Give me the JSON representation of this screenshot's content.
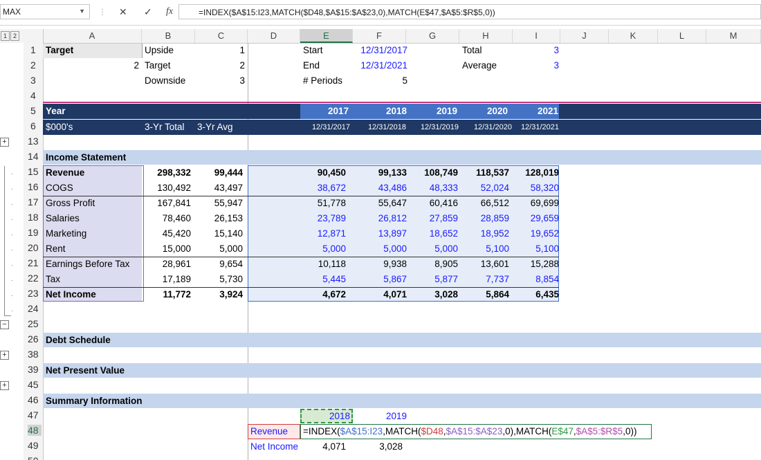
{
  "namebox": "MAX",
  "formula": "=INDEX($A$15:I23,MATCH($D48,$A$15:$A$23,0),MATCH(E$47,$A$5:$R$5,0))",
  "formula_parts": {
    "p1": "=INDEX(",
    "p2": "$A$15:I23",
    "p3": ",MATCH(",
    "p4": "$D48",
    "p5": ",",
    "p6": "$A$15:$A$23",
    "p7": ",0),MATCH(",
    "p8": "E$47",
    "p9": ",",
    "p10": "$A$5:$R$5",
    "p11": ",0))"
  },
  "columns": [
    "A",
    "B",
    "C",
    "D",
    "E",
    "F",
    "G",
    "H",
    "I",
    "J",
    "K",
    "L",
    "M"
  ],
  "outline_levels": [
    "1",
    "2"
  ],
  "rows": [
    "1",
    "2",
    "3",
    "4",
    "5",
    "6",
    "13",
    "14",
    "15",
    "16",
    "17",
    "18",
    "19",
    "20",
    "21",
    "22",
    "23",
    "24",
    "25",
    "26",
    "38",
    "39",
    "45",
    "46",
    "47",
    "48",
    "49",
    "50"
  ],
  "top": {
    "a1": "Target",
    "b1": "Upside",
    "c1": "1",
    "a2": "2",
    "b2": "Target",
    "c2": "2",
    "b3": "Downside",
    "c3": "3",
    "e1": "Start",
    "f1": "12/31/2017",
    "e2": "End",
    "f2": "12/31/2021",
    "e3": "# Periods",
    "f3": "5",
    "h1": "Total",
    "i1": "3",
    "h2": "Average",
    "i2": "3"
  },
  "header": {
    "year": "Year",
    "units": "$000's",
    "total": "3-Yr Total",
    "avg": "3-Yr Avg",
    "years": [
      "2017",
      "2018",
      "2019",
      "2020",
      "2021"
    ],
    "dates": [
      "12/31/2017",
      "12/31/2018",
      "12/31/2019",
      "12/31/2020",
      "12/31/2021"
    ]
  },
  "income": {
    "title": "Income Statement",
    "rows": [
      {
        "label": "Revenue",
        "total": "298,332",
        "avg": "99,444",
        "v": [
          "90,450",
          "99,133",
          "108,749",
          "118,537",
          "128,019"
        ]
      },
      {
        "label": "COGS",
        "total": "130,492",
        "avg": "43,497",
        "v": [
          "38,672",
          "43,486",
          "48,333",
          "52,024",
          "58,320"
        ]
      },
      {
        "label": "Gross Profit",
        "total": "167,841",
        "avg": "55,947",
        "v": [
          "51,778",
          "55,647",
          "60,416",
          "66,512",
          "69,699"
        ]
      },
      {
        "label": "Salaries",
        "total": "78,460",
        "avg": "26,153",
        "v": [
          "23,789",
          "26,812",
          "27,859",
          "28,859",
          "29,659"
        ]
      },
      {
        "label": "Marketing",
        "total": "45,420",
        "avg": "15,140",
        "v": [
          "12,871",
          "13,897",
          "18,652",
          "18,952",
          "19,652"
        ]
      },
      {
        "label": "Rent",
        "total": "15,000",
        "avg": "5,000",
        "v": [
          "5,000",
          "5,000",
          "5,000",
          "5,100",
          "5,100"
        ]
      },
      {
        "label": "Earnings Before Tax",
        "total": "28,961",
        "avg": "9,654",
        "v": [
          "10,118",
          "9,938",
          "8,905",
          "13,601",
          "15,288"
        ]
      },
      {
        "label": "Tax",
        "total": "17,189",
        "avg": "5,730",
        "v": [
          "5,445",
          "5,867",
          "5,877",
          "7,737",
          "8,854"
        ]
      },
      {
        "label": "Net Income",
        "total": "11,772",
        "avg": "3,924",
        "v": [
          "4,672",
          "4,071",
          "3,028",
          "5,864",
          "6,435"
        ]
      }
    ]
  },
  "sections": {
    "debt": "Debt Schedule",
    "npv": "Net Present Value",
    "summary": "Summary Information"
  },
  "summary": {
    "y1": "2018",
    "y2": "2019",
    "rev_label": "Revenue",
    "ni_label": "Net Income",
    "ni_1": "4,071",
    "ni_2": "3,028"
  },
  "colors": {
    "navy": "#1f3864",
    "band": "#c5d5ed",
    "blue_input": "#1a1aff",
    "excel_green": "#217346"
  }
}
